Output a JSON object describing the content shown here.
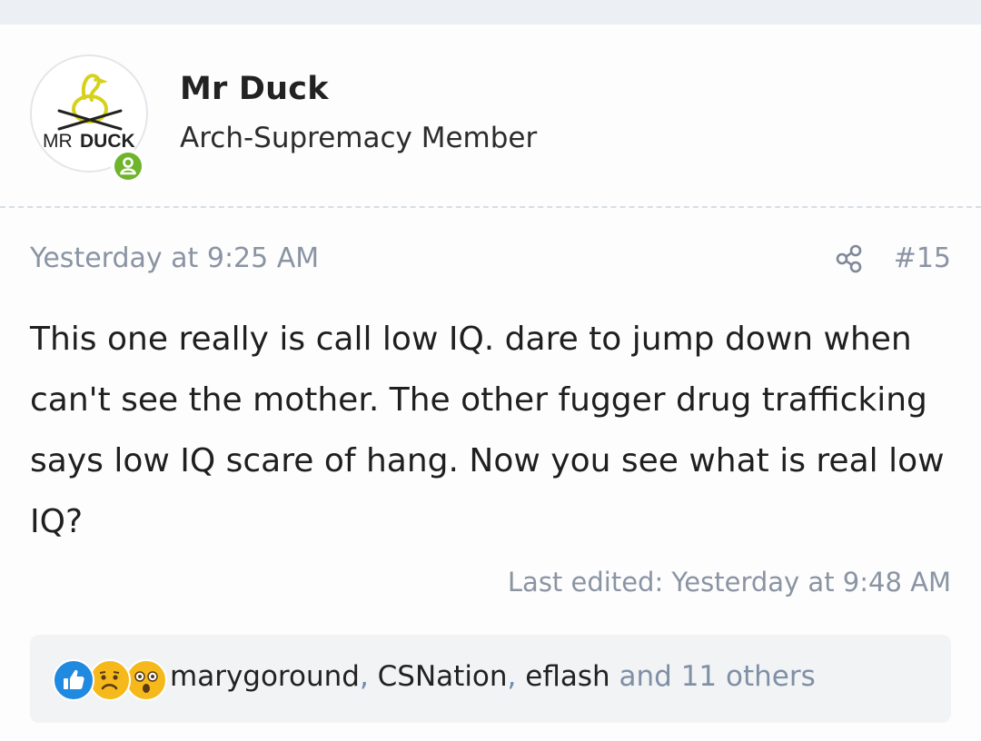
{
  "post": {
    "author": {
      "name": "Mr Duck",
      "title": "Arch-Supremacy Member",
      "avatar_text_left": "MR",
      "avatar_text_right": "DUCK",
      "online": true
    },
    "date": "Yesterday at 9:25 AM",
    "post_number": "#15",
    "message": "This one really is call low IQ. dare to jump down when can't see the mother. The other fugger drug trafficking says low IQ scare of hang. Now you see what is real low IQ?",
    "last_edited": "Last edited: Yesterday at 9:48 AM",
    "reactions": {
      "icons": [
        "like-icon",
        "sad-face-icon",
        "surprised-face-icon"
      ],
      "users": [
        "marygoround",
        "CSNation",
        "eflash"
      ],
      "separator": ", ",
      "more_text": "and 11 others"
    }
  },
  "colors": {
    "muted_text": "#8a94a3",
    "online_green": "#6fb52c",
    "like_blue": "#1f8ae0",
    "emoji_yellow": "#f6b91c"
  }
}
